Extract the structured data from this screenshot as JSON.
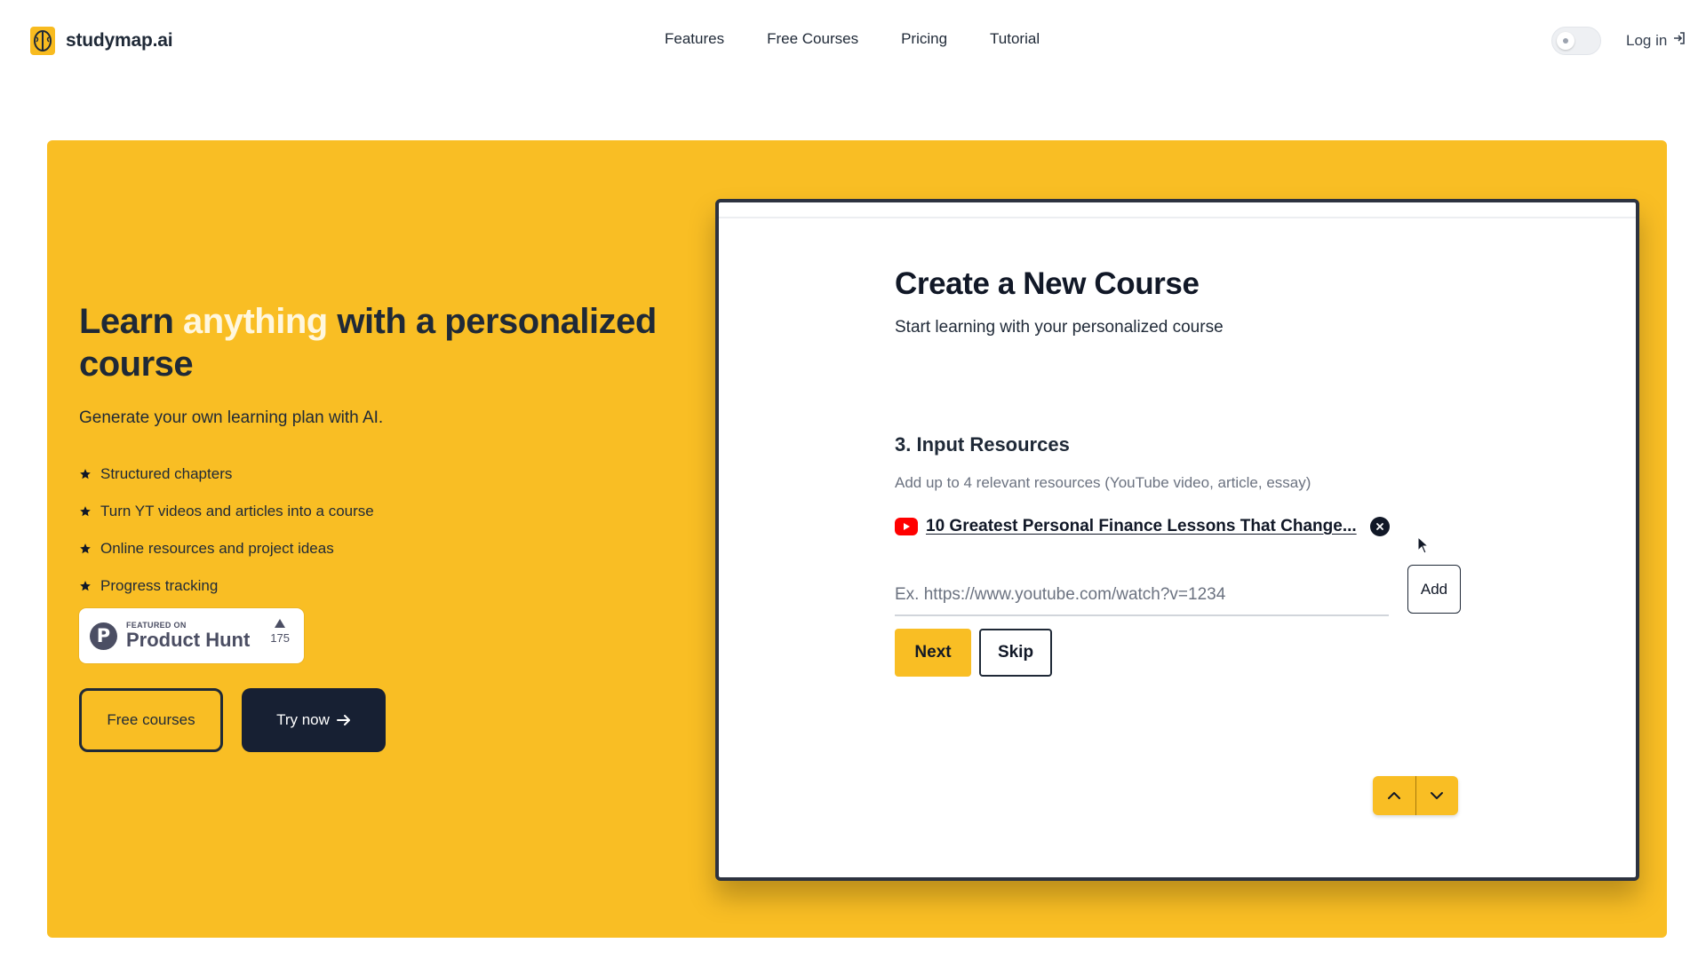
{
  "nav": {
    "brand": "studymap.ai",
    "links": [
      "Features",
      "Free Courses",
      "Pricing",
      "Tutorial"
    ],
    "login": "Log in"
  },
  "hero": {
    "title_before": "Learn ",
    "title_accent": "anything",
    "title_after": " with a personalized course",
    "subtitle": "Generate your own learning plan with AI.",
    "features": [
      "Structured chapters",
      "Turn YT videos and articles into a course",
      "Online resources and project ideas",
      "Progress tracking"
    ],
    "product_hunt": {
      "featured": "FEATURED ON",
      "name": "Product Hunt",
      "votes": "175"
    },
    "free_button": "Free courses",
    "try_button": "Try now"
  },
  "card": {
    "title": "Create a New Course",
    "subtitle": "Start learning with your personalized course",
    "step_title": "3. Input Resources",
    "step_hint": "Add up to 4 relevant resources (YouTube video, article, essay)",
    "resource_title": "10 Greatest Personal Finance Lessons That Change...",
    "input_placeholder": "Ex. https://www.youtube.com/watch?v=1234",
    "add_button": "Add",
    "next_button": "Next",
    "skip_button": "Skip"
  },
  "colors": {
    "accent": "#f9be24",
    "dark": "#172033",
    "youtube": "#ff0000"
  },
  "icons": [
    "brain-logo-icon",
    "sun-icon",
    "login-icon",
    "star-icon",
    "arrow-right-icon",
    "youtube-icon",
    "close-circle-icon",
    "chevron-up-icon",
    "chevron-down-icon",
    "cursor-icon"
  ]
}
